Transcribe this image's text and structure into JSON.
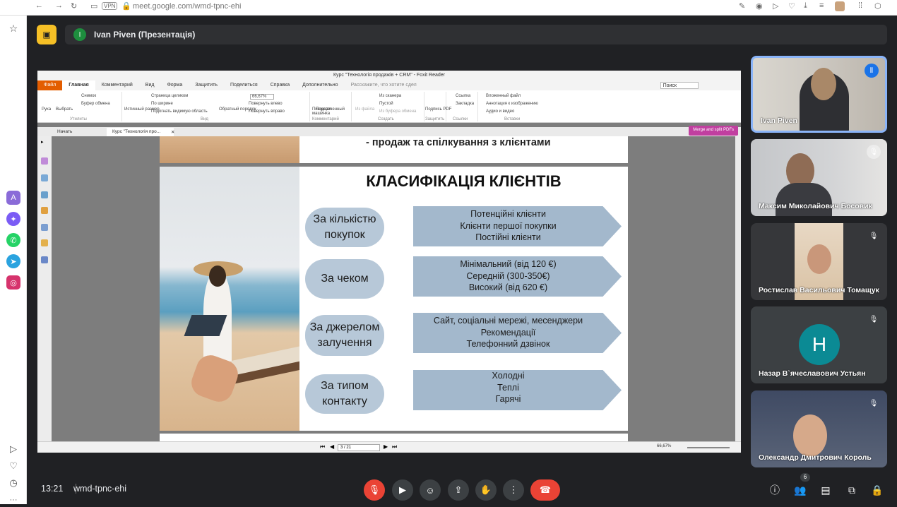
{
  "browser": {
    "url": "meet.google.com/wmd-tpnc-ehi",
    "vpn_label": "VPN"
  },
  "presentation_bar": {
    "avatar_letter": "I",
    "title": "Ivan Piven (Презентація)"
  },
  "foxit": {
    "window_title": "Курс \"Технологія продажів + CRM\" - Foxit Reader",
    "menu": [
      "Файл",
      "Главная",
      "Комментарий",
      "Вид",
      "Форма",
      "Защитить",
      "Поделиться",
      "Справка",
      "Дополнительно"
    ],
    "tell_me": "Расскажите, что хотите сдел",
    "search_placeholder": "Поиск",
    "ribbon": {
      "hand": "Рука",
      "select": "Выбрать",
      "snapshot": "Снимок",
      "clipboard": "Буфер обмена",
      "utilities": "Утилиты",
      "actual_size": "Истинный размер",
      "fit_page": "Страница целиком",
      "fit_width": "По ширине",
      "fit_visible": "Подогнать видимую область",
      "reverse": "Обратный порядок",
      "zoom": "66,67%",
      "rotate_left": "Повернуть влево",
      "rotate_right": "Повернуть вправо",
      "view": "Вид",
      "typewriter": "Пишущая машинка",
      "highlight": "Подсвеченный",
      "comments": "Комментарий",
      "from_file": "Из файла",
      "from_scanner": "Из сканера",
      "blank": "Пустой",
      "from_clipboard": "Из буфера обмена",
      "create": "Создать",
      "sign_pdf": "Подпись PDF",
      "protect": "Защитить",
      "link": "Ссылка",
      "bookmark": "Закладка",
      "links": "Ссылки",
      "attachment": "Вложенный файл",
      "image_annotation": "Аннотация к изображению",
      "audio_video": "Аудио и видео",
      "insert": "Вставки"
    },
    "tabs": [
      "Начать",
      "Курс \"Технологія про..."
    ],
    "merge_label": "Merge and split PDFs",
    "page_indicator": "3 / 21",
    "zoom_status": "66,67%"
  },
  "slides": {
    "prev_slide_text": "- продаж та спілкування з клієнтами",
    "title": "КЛАСИФІКАЦІЯ КЛІЄНТІВ",
    "rows": [
      {
        "category": "За кількістю покупок",
        "items": [
          "Потенційні клієнти",
          "Клієнти першої покупки",
          "Постійні клієнти"
        ]
      },
      {
        "category": "За чеком",
        "items": [
          "Мінімальний (від 120 €)",
          "Середній (300-350€)",
          "Високий (від 620 €)"
        ]
      },
      {
        "category": "За джерелом залучення",
        "items": [
          "Сайт, соціальні мережі, месенджери",
          "Рекомендації",
          "Телефонний дзвінок"
        ]
      },
      {
        "category": "За типом контакту",
        "items": [
          "Холодні",
          "Теплі",
          "Гарячі"
        ]
      }
    ]
  },
  "participants": [
    {
      "name": "Ivan Piven",
      "speaking": true
    },
    {
      "name": "Максим Миколайович Босовик",
      "muted": true
    },
    {
      "name": "Ростислав Васильович Томащук",
      "muted": true
    },
    {
      "name": "Назар В`ячеславович Устьян",
      "muted": true,
      "initial": "Н"
    },
    {
      "name": "Олександр Дмитрович Король",
      "muted": true
    }
  ],
  "bottom": {
    "time": "13:21",
    "meeting_code": "wmd-tpnc-ehi",
    "people_count": "6"
  },
  "colors": {
    "meet_bg": "#202124",
    "end_call": "#ea4335",
    "mic_off": "#ea4335",
    "present_accent": "#f6c026",
    "slide_arrow": "#a3b8cc",
    "slide_pill": "#b7c8d8"
  }
}
